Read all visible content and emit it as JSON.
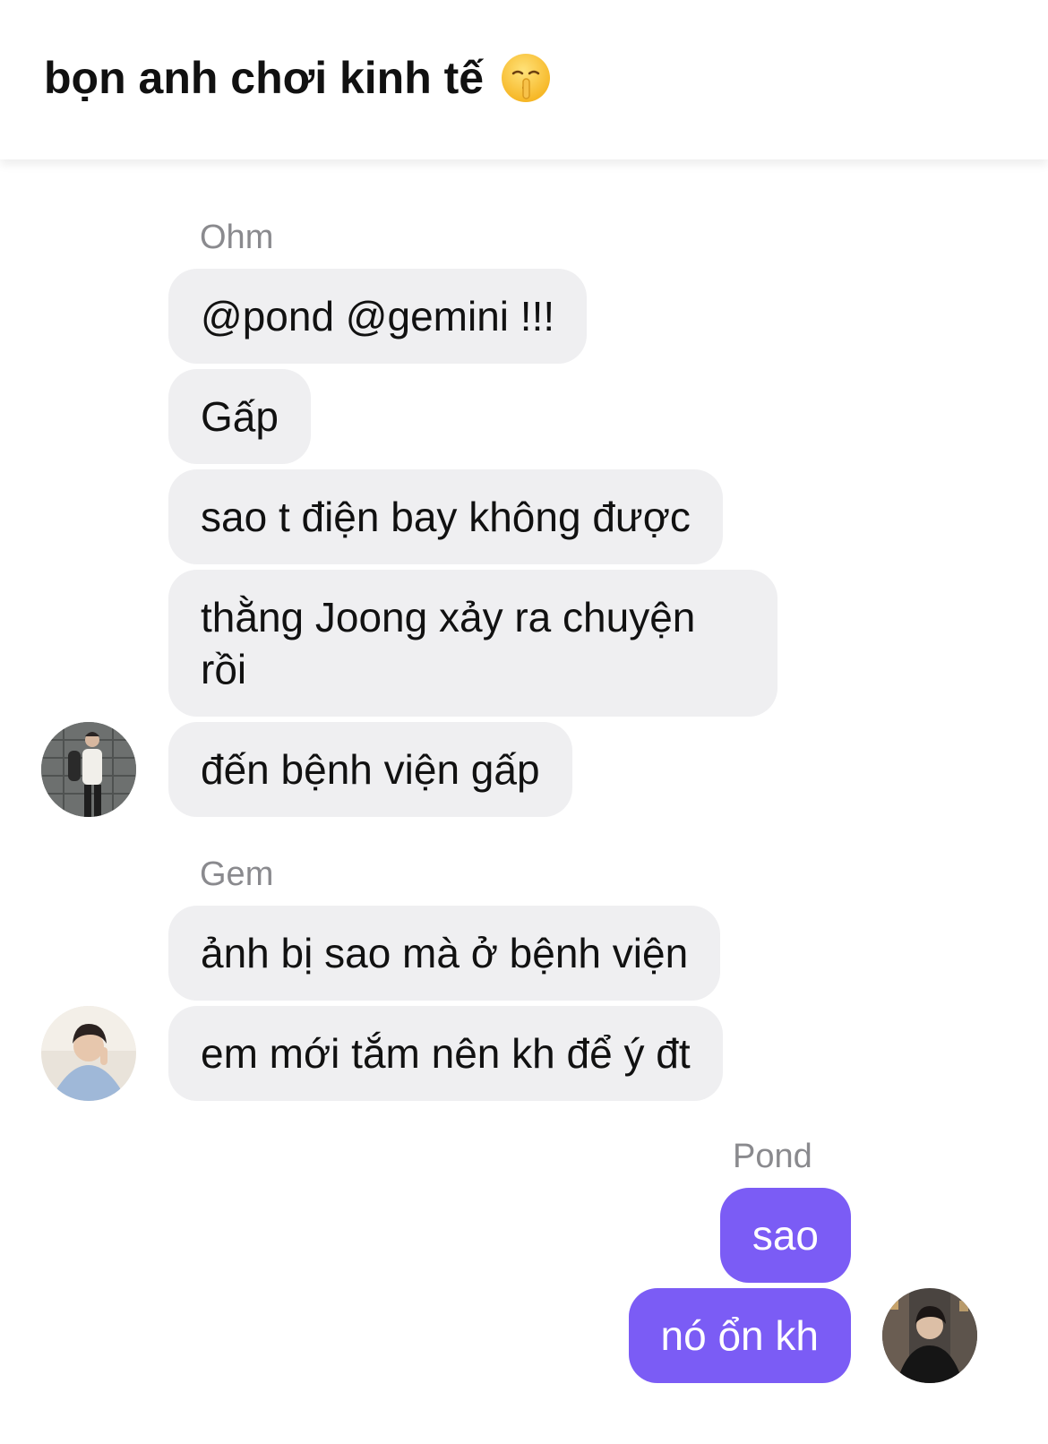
{
  "header": {
    "title": "bọn anh chơi kinh tế",
    "emoji_icon": "shushing-face-icon"
  },
  "colors": {
    "my_bubble": "#7b5cf5",
    "other_bubble": "#efeff1",
    "sender_name": "#8a8a8e"
  },
  "groups": [
    {
      "sender": "Ohm",
      "messages": [
        "@pond @gemini !!!",
        "Gấp",
        "sao t điện bay không được",
        "thằng Joong xảy ra chuyện rồi",
        "đến bệnh viện gấp"
      ]
    },
    {
      "sender": "Gem",
      "messages": [
        "ảnh bị sao mà ở bệnh viện",
        "em mới tắm nên kh để ý đt"
      ]
    },
    {
      "sender": "Pond",
      "messages": [
        "sao",
        "nó ổn kh"
      ]
    }
  ]
}
